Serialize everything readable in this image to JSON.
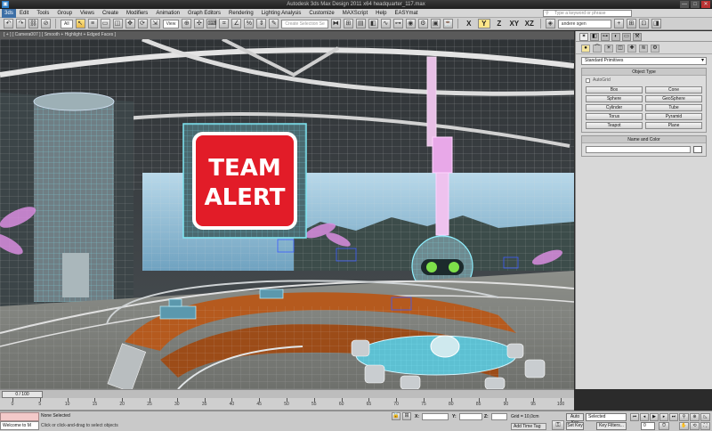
{
  "window": {
    "title": "Autodesk 3ds Max Design 2011 x64    headquarter_117.max",
    "minimize": "—",
    "maximize": "□",
    "close": "✕"
  },
  "menubar": {
    "logo": "3ds",
    "items": [
      "Edit",
      "Tools",
      "Group",
      "Views",
      "Create",
      "Modifiers",
      "Animation",
      "Graph Editors",
      "Rendering",
      "Lighting Analysis",
      "Customize",
      "MAXScript",
      "Help",
      "EASYmat"
    ],
    "search_placeholder": "Type a keyword or phrase"
  },
  "toolbar": {
    "filter_select": "All",
    "view_select": "View",
    "selection_set": "Create Selection Se",
    "axis_x": "X",
    "axis_y": "Y",
    "axis_z": "Z",
    "axis_xy": "XY",
    "axis_xz": "XZ",
    "layer_select": "andere sgen"
  },
  "viewport": {
    "label": "[ + ] [ Camera007 ] [ Smooth + Highlight + Edged Faces ]",
    "sign_line1": "TEAM",
    "sign_line2": "ALERT"
  },
  "command_panel": {
    "category": "Standard Primitives",
    "object_type_header": "Object Type",
    "autogrid": "AutoGrid",
    "objects": [
      "Box",
      "Cone",
      "Sphere",
      "GeoSphere",
      "Cylinder",
      "Tube",
      "Torus",
      "Pyramid",
      "Teapot",
      "Plane"
    ],
    "name_color_header": "Name and Color"
  },
  "timeline": {
    "slider": "0 / 100",
    "ticks": [
      "0",
      "5",
      "10",
      "15",
      "20",
      "25",
      "30",
      "35",
      "40",
      "45",
      "50",
      "55",
      "60",
      "65",
      "70",
      "75",
      "80",
      "85",
      "90",
      "95",
      "100"
    ]
  },
  "status": {
    "maxscript_text": "Welcome to M",
    "selection": "None Selected",
    "prompt": "Click or click-and-drag to select objects",
    "x_label": "X:",
    "y_label": "Y:",
    "z_label": "Z:",
    "grid": "Grid = 10,0cm",
    "add_time_tag": "Add Time Tag",
    "auto_key": "Auto Key",
    "set_key": "Set Key",
    "key_mode": "Selected",
    "key_filters": "Key Filters...",
    "frame": "0"
  }
}
